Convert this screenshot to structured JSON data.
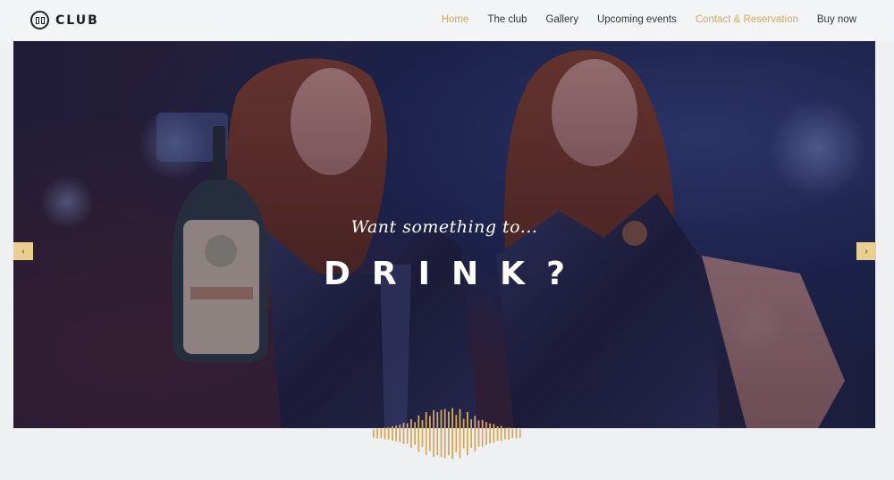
{
  "brand": {
    "name": "CLUB"
  },
  "nav": {
    "items": [
      {
        "label": "Home",
        "active": true
      },
      {
        "label": "The club",
        "active": false
      },
      {
        "label": "Gallery",
        "active": false
      },
      {
        "label": "Upcoming events",
        "active": false
      },
      {
        "label": "Contact & Reservation",
        "active": true
      },
      {
        "label": "Buy now",
        "active": false
      }
    ]
  },
  "hero": {
    "subtitle": "Want something to...",
    "headline": "DRINK?",
    "prev_icon": "chevron-left-icon",
    "next_icon": "chevron-right-icon",
    "prev_glyph": "‹",
    "next_glyph": "›"
  },
  "colors": {
    "accent": "#d7a85b",
    "arrow_bg": "#e8cf8f",
    "page_bg": "#eef0f1",
    "text_dark": "#333333"
  }
}
